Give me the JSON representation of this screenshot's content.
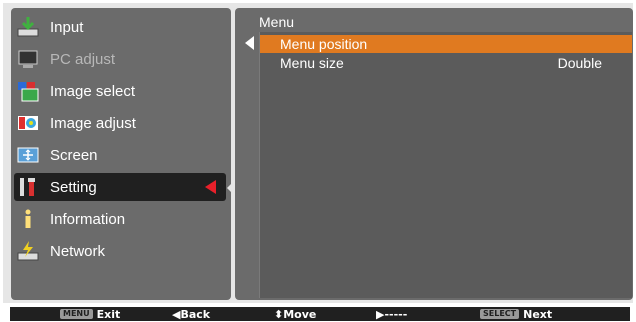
{
  "sidebar": {
    "items": [
      {
        "label": "Input",
        "icon": "input-icon"
      },
      {
        "label": "PC adjust",
        "icon": "pc-adjust-icon"
      },
      {
        "label": "Image select",
        "icon": "image-select-icon"
      },
      {
        "label": "Image adjust",
        "icon": "image-adjust-icon"
      },
      {
        "label": "Screen",
        "icon": "screen-icon"
      },
      {
        "label": "Setting",
        "icon": "setting-icon"
      },
      {
        "label": "Information",
        "icon": "information-icon"
      },
      {
        "label": "Network",
        "icon": "network-icon"
      }
    ],
    "selected_index": 5,
    "disabled_index": 1
  },
  "panel": {
    "title": "Menu",
    "options": [
      {
        "label": "Menu position",
        "value": ""
      },
      {
        "label": "Menu size",
        "value": "Double"
      }
    ],
    "highlighted_index": 0
  },
  "footer": {
    "exit_key": "MENU",
    "exit_label": "Exit",
    "back_label": "◀Back",
    "move_label": "⬍Move",
    "next_arrow_label": "▶-----",
    "next_key": "SELECT",
    "next_label": "Next"
  },
  "colors": {
    "highlight": "#e07a20",
    "selected_arrow": "#e8202a"
  }
}
